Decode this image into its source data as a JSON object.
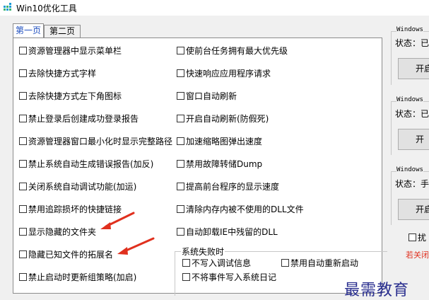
{
  "window": {
    "title": "Win10优化工具",
    "icon": "app-grid-icon"
  },
  "tabs": [
    {
      "label": "第一页",
      "active": true
    },
    {
      "label": "第二页",
      "active": false
    }
  ],
  "left_column": [
    {
      "label": "资源管理器中显示菜单栏",
      "checked": false
    },
    {
      "label": "去除快捷方式字样",
      "checked": false
    },
    {
      "label": "去除快捷方式左下角图标",
      "checked": false
    },
    {
      "label": "禁止登录后创建成功登录报告",
      "checked": false
    },
    {
      "label": "资源管理器窗口最小化时显示完整路径",
      "checked": false
    },
    {
      "label": "禁止系统自动生成错误报告(加反)",
      "checked": false
    },
    {
      "label": "关闭系统自动调试功能(加运)",
      "checked": false
    },
    {
      "label": "禁用追踪损坏的快捷链接",
      "checked": false
    },
    {
      "label": "显示隐藏的文件夹",
      "checked": false
    },
    {
      "label": "隐藏已知文件的拓展名",
      "checked": false
    },
    {
      "label": "禁止启动时更新组策略(加启)",
      "checked": false
    }
  ],
  "right_column": [
    {
      "label": "使前台任务拥有最大优先级",
      "checked": false
    },
    {
      "label": "快速响应应用程序请求",
      "checked": false
    },
    {
      "label": "窗口自动刷新",
      "checked": false
    },
    {
      "label": "开启自动刷新(防假死)",
      "checked": false
    },
    {
      "label": "加速缩略图弹出速度",
      "checked": false
    },
    {
      "label": "禁用故障转储Dump",
      "checked": false
    },
    {
      "label": "提高前台程序的显示速度",
      "checked": false
    },
    {
      "label": "清除内存内被不使用的DLL文件",
      "checked": false
    },
    {
      "label": "自动卸载IE中残留的DLL",
      "checked": false
    }
  ],
  "system_failure": {
    "title": "系统失败时",
    "options": [
      {
        "label": "不写入调试信息",
        "checked": false
      },
      {
        "label": "禁用自动重新启动",
        "checked": false
      },
      {
        "label": "不将事件写入系统日记",
        "checked": false
      }
    ]
  },
  "side_groups": [
    {
      "title": "Windows ",
      "status": "状态：已",
      "button": "开启"
    },
    {
      "title": "Windows ",
      "status": "状态：已",
      "button": "开"
    },
    {
      "title": "Windows ",
      "status": "状态：手",
      "button": "开启"
    }
  ],
  "side_checkbox": {
    "label": "扰",
    "checked": false
  },
  "side_warning": "若关闭",
  "watermark": "最需教育",
  "colors": {
    "tab_active_text": "#1f4fbf",
    "arrow": "#e0301e",
    "warning": "#e0301e",
    "watermark": "#2a2f8f"
  }
}
